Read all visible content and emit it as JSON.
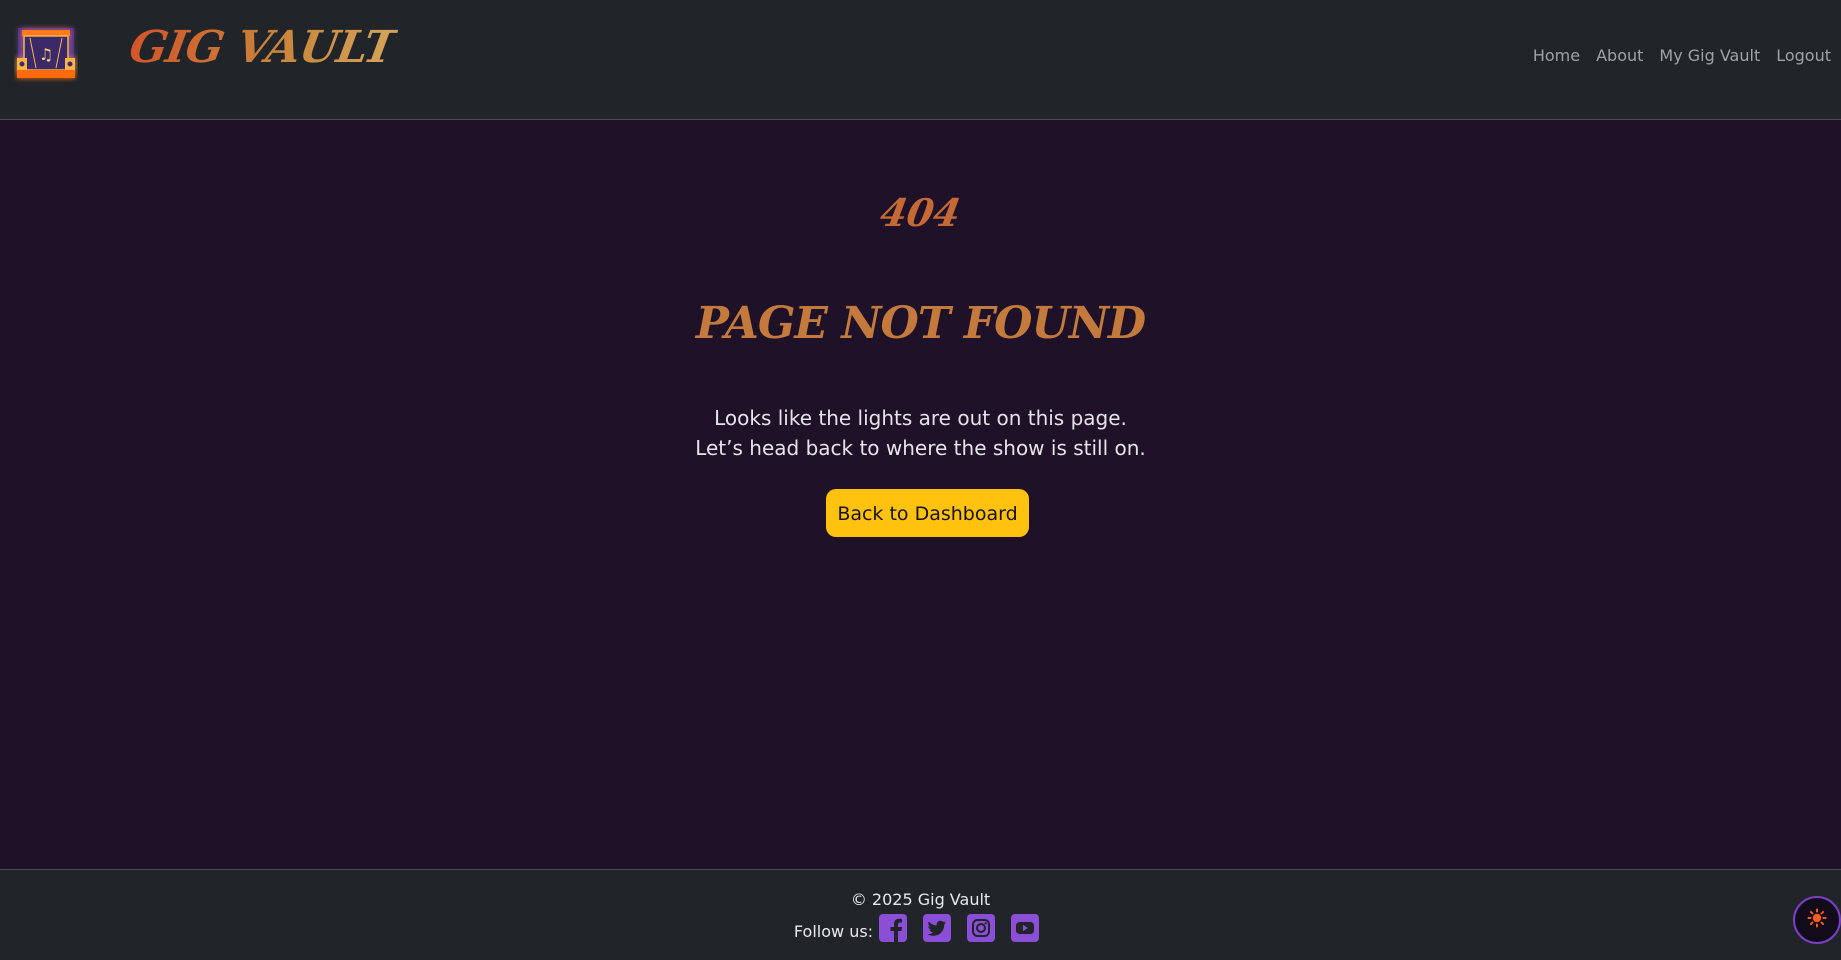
{
  "header": {
    "brand": "Gig Vault",
    "nav": [
      {
        "label": "Home"
      },
      {
        "label": "About"
      },
      {
        "label": "My Gig Vault"
      },
      {
        "label": "Logout"
      }
    ]
  },
  "main": {
    "code": "404",
    "heading": "Page Not Found",
    "line1": "Looks like the lights are out on this page.",
    "line2": "Let’s head back to where the show is still on.",
    "button_label": "Back to Dashboard"
  },
  "footer": {
    "copyright": "© 2025 Gig Vault",
    "follow_label": "Follow us:",
    "socials": [
      "facebook-icon",
      "twitter-icon",
      "instagram-icon",
      "youtube-icon"
    ]
  },
  "theme_toggle_icon": "sun-icon",
  "colors": {
    "accent": "#ffc20e",
    "social": "#8a4fd6",
    "background": "#1e1128",
    "bar": "#212529"
  }
}
